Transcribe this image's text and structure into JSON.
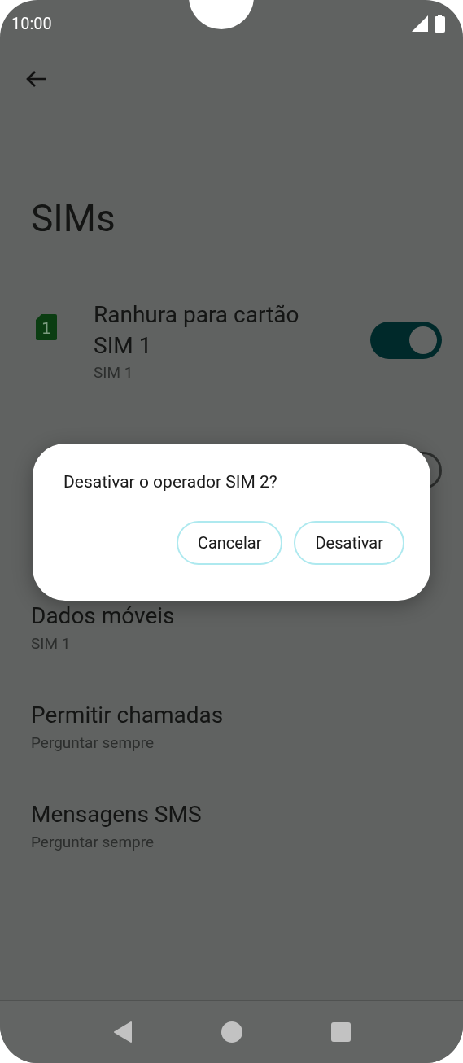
{
  "status_bar": {
    "time": "10:00"
  },
  "title": "SIMs",
  "sim_slots": [
    {
      "title": "Ranhura para cartão SIM 1",
      "subtitle": "SIM 1",
      "badge": "1",
      "on": true
    },
    {
      "on": false
    }
  ],
  "settings": [
    {
      "title": "Dados móveis",
      "subtitle": "SIM 1"
    },
    {
      "title": "Permitir chamadas",
      "subtitle": "Perguntar sempre"
    },
    {
      "title": "Mensagens SMS",
      "subtitle": "Perguntar sempre"
    }
  ],
  "dialog": {
    "message": "Desativar o operador SIM 2?",
    "buttons": [
      "Cancelar",
      "Desativar"
    ]
  }
}
